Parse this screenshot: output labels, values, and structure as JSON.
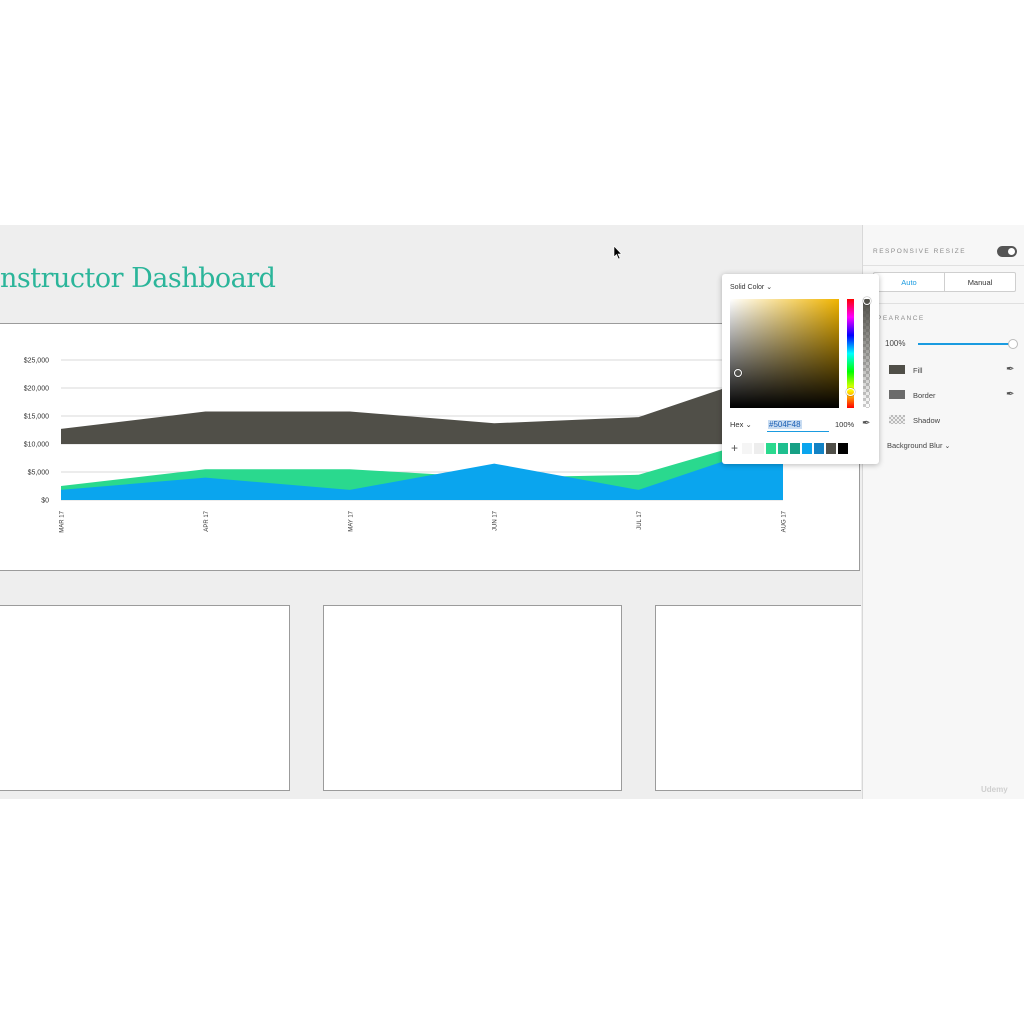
{
  "page": {
    "title": "nstructor Dashboard"
  },
  "chart_data": {
    "type": "area",
    "categories": [
      "MAR 17",
      "APR 17",
      "MAY 17",
      "JUN 17",
      "JUL 17",
      "AUG 17"
    ],
    "y_ticks": [
      "$25,000",
      "$20,000",
      "$15,000",
      "$10,000",
      "$5,000",
      "$0"
    ],
    "ylim": [
      0,
      25000
    ],
    "grid": true,
    "series": [
      {
        "color": "#504F48",
        "band": [
          10000,
          26000
        ],
        "values": [
          12700,
          15800,
          15800,
          13700,
          14800,
          23500
        ]
      },
      {
        "color": "#2AD98E",
        "values": [
          2500,
          5500,
          5500,
          4000,
          4500,
          12000
        ]
      },
      {
        "color": "#0AA5EE",
        "values": [
          1800,
          4000,
          1800,
          6500,
          1800,
          10500
        ]
      }
    ]
  },
  "right_panel": {
    "responsive_resize_label": "RESPONSIVE RESIZE",
    "auto_label": "Auto",
    "manual_label": "Manual",
    "appearance_label": "PEARANCE",
    "opacity_value": "100%",
    "opacity_fraction": 1.0,
    "fill_label": "Fill",
    "border_label": "Border",
    "shadow_label": "Shadow",
    "background_blur_label": "Background Blur",
    "fill_color": "#504F48",
    "border_color": "#6b6b6b"
  },
  "color_picker": {
    "mode_label": "Solid Color",
    "format_label": "Hex",
    "hex_value": "#504F48",
    "alpha_value": "100%",
    "presets": [
      "#f5f5f5",
      "#ededed",
      "#2ad98e",
      "#1fbf8f",
      "#16a085",
      "#0aa5ee",
      "#1282c4",
      "#504f48",
      "#000000"
    ]
  },
  "watermark": "Udemy"
}
